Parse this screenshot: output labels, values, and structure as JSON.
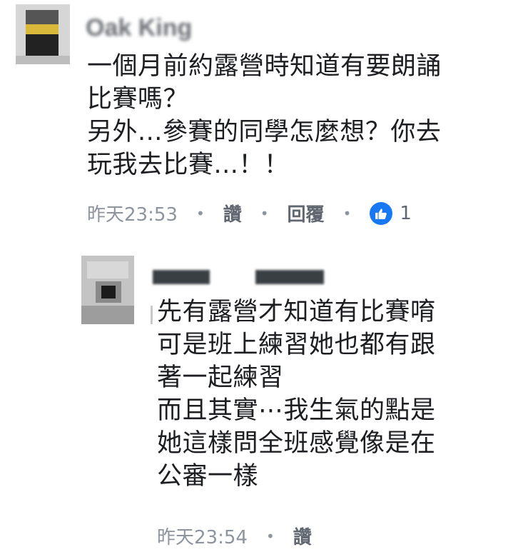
{
  "comments": [
    {
      "author": "Oak King",
      "lines": [
        "一個月前約露營時知道有要朗誦",
        "比賽嗎？",
        "另外...參賽的同學怎麼想？你去",
        "玩我去比賽...！！"
      ],
      "time": "昨天23:53",
      "like_label": "讚",
      "reply_label": "回覆",
      "reaction_count": "1"
    },
    {
      "lines": [
        "先有露營才知道有比賽唷",
        "可是班上練習她也都有跟",
        "著一起練習",
        "而且其實⋯我生氣的點是",
        "她這樣問全班感覺像是在",
        "公審一樣"
      ],
      "time": "昨天23:54",
      "like_label": "讚"
    }
  ],
  "colors": {
    "text": "#1c1e21",
    "meta": "#8d949e",
    "link": "#606770",
    "like_blue": "#1877f2"
  }
}
